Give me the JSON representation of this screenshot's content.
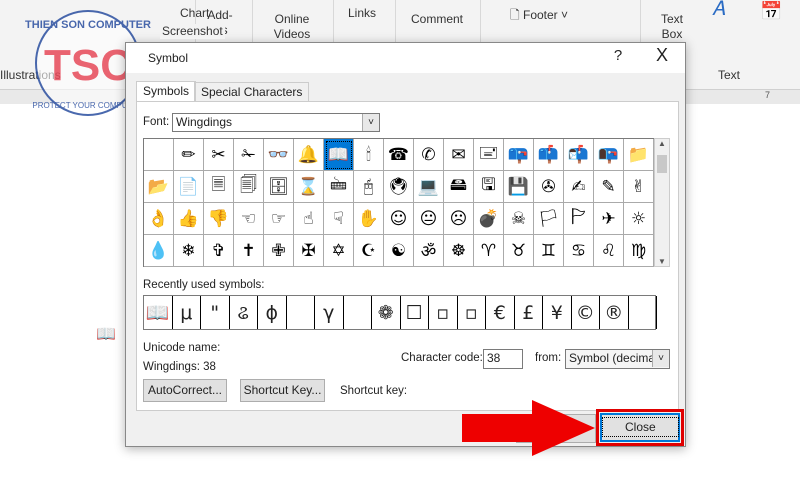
{
  "ribbon": {
    "items": [
      "Chart",
      "Screenshot",
      "Illustrations",
      "Add-ins",
      "Online Videos",
      "Links",
      "Comment",
      "Footer",
      "Text Box",
      "Text"
    ]
  },
  "logo": {
    "text": "TSC",
    "ring_text": "THIEN SON COMPUTER - PROTECT YOUR COMPUTER"
  },
  "ruler": {
    "mark": "7"
  },
  "document": {
    "symbol": "📖"
  },
  "dialog": {
    "title": "Symbol",
    "help": "?",
    "close_x": "X",
    "tabs": [
      "Symbols",
      "Special Characters"
    ],
    "font_label": "Font:",
    "font_value": "Wingdings",
    "symbols": [
      [
        "",
        "✏",
        "✂",
        "✁",
        "👓",
        "🔔",
        "📖",
        "🕯",
        "☎",
        "✆",
        "✉",
        "🖃",
        "📪",
        "📫",
        "📬",
        "📭",
        "📁"
      ],
      [
        "📂",
        "📄",
        "🗏",
        "🗐",
        "🗄",
        "⌛",
        "🖮",
        "🖰",
        "🖲",
        "💻",
        "🖴",
        "🖫",
        "💾",
        "✇",
        "✍",
        "✎",
        "✌"
      ],
      [
        "👌",
        "👍",
        "👎",
        "☜",
        "☞",
        "☝",
        "☟",
        "✋",
        "☺",
        "😐",
        "☹",
        "💣",
        "☠",
        "🏳",
        "🏱",
        "✈",
        "☼"
      ],
      [
        "💧",
        "❄",
        "✞",
        "✝",
        "✙",
        "✠",
        "✡",
        "☪",
        "☯",
        "ॐ",
        "☸",
        "♈",
        "♉",
        "♊",
        "♋",
        "♌",
        "♍"
      ]
    ],
    "selected_symbol": "📖",
    "recent_label": "Recently used symbols:",
    "recent": [
      "📖",
      "μ",
      "\"",
      "ଌ",
      "ϕ",
      "",
      "γ",
      "",
      "❁",
      "☐",
      "▫",
      "▫",
      "€",
      "£",
      "¥",
      "©",
      "®",
      ""
    ],
    "unicode_name_label": "Unicode name:",
    "unicode_name_value": "Wingdings: 38",
    "char_code_label": "Character code:",
    "char_code_value": "38",
    "from_label": "from:",
    "from_value": "Symbol (decimal)",
    "autocorrect": "AutoCorrect...",
    "shortcut_key_btn": "Shortcut Key...",
    "shortcut_key_label": "Shortcut key:",
    "close": "Close"
  },
  "colors": {
    "accent": "#0078d7",
    "highlight": "#e00000"
  }
}
